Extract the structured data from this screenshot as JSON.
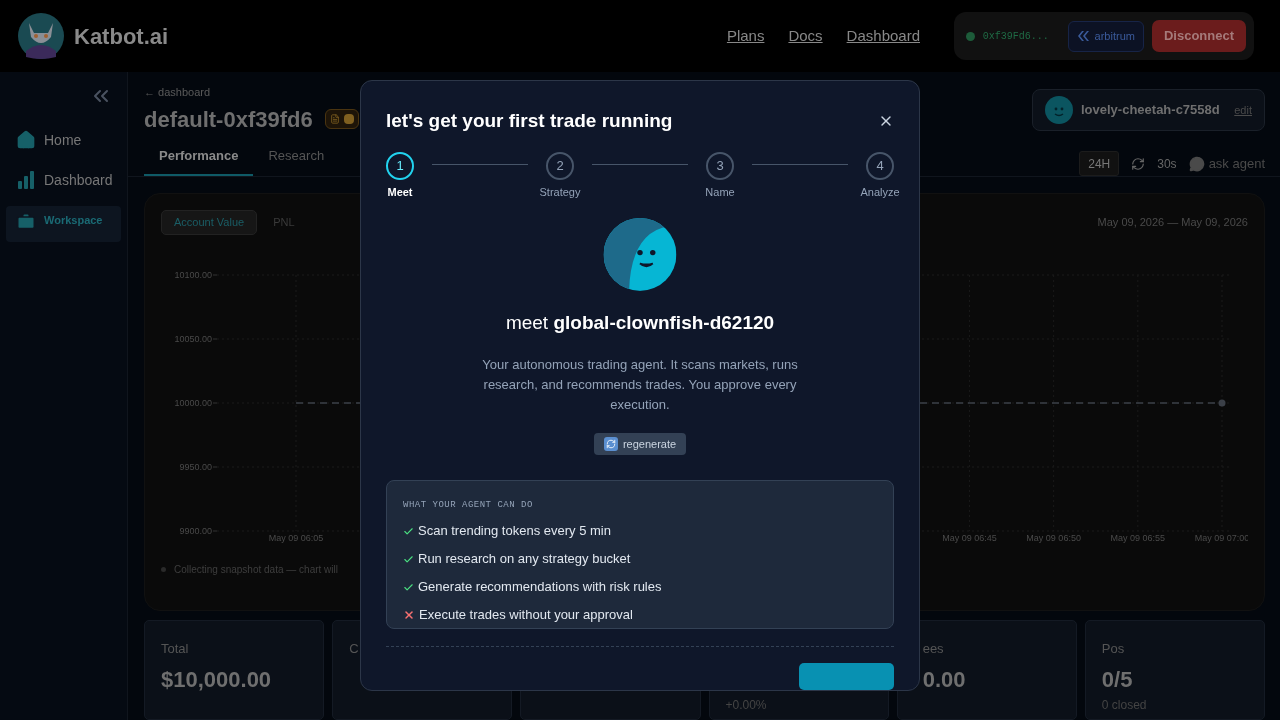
{
  "header": {
    "brand": "Katbot.ai",
    "nav": [
      "Plans",
      "Docs",
      "Dashboard"
    ],
    "wallet": {
      "address": "0xf39Fd6...",
      "connected": true,
      "network": "arbitrum",
      "disconnect": "Disconnect"
    }
  },
  "sidebar": {
    "items": [
      {
        "label": "Home",
        "selected": false
      },
      {
        "label": "Dashboard",
        "selected": false
      },
      {
        "label": "Workspace",
        "selected": true
      }
    ]
  },
  "page": {
    "breadcrumb": "← dashboard",
    "title": "default-0xf39fd6",
    "tabs": [
      {
        "label": "Performance",
        "selected": true
      },
      {
        "label": "Research",
        "selected": false
      }
    ],
    "agent": {
      "name": "lovely-cheetah-c7558d",
      "edit": "edit"
    },
    "controls": {
      "range": "24H",
      "refresh": "30s",
      "ask": "ask agent"
    }
  },
  "chart_panel": {
    "toggles": [
      {
        "label": "Account Value",
        "selected": true
      },
      {
        "label": "PNL",
        "selected": false
      }
    ],
    "date_range": "May 09, 2026 — May 09, 2026",
    "note": "Collecting snapshot data — chart will",
    "chart_data": {
      "type": "line",
      "categories": [
        "May 09 06:05",
        null,
        null,
        null,
        null,
        null,
        null,
        null,
        "May 09 06:45",
        "May 09 06:50",
        "May 09 06:55",
        "May 09 07:00"
      ],
      "ylim": [
        9900,
        10100
      ],
      "yticks": [
        {
          "value": 10100,
          "label": "10100.00"
        },
        {
          "value": 10050,
          "label": "10050.00"
        },
        {
          "value": 10000,
          "label": "10000.00"
        },
        {
          "value": 9950,
          "label": "9950.00"
        },
        {
          "value": 9900,
          "label": "9900.00"
        }
      ],
      "grid": true,
      "series": [
        {
          "color": "#3b4048",
          "line_style": "dashed",
          "values": [
            10000,
            null,
            null,
            null,
            null,
            null,
            null,
            null,
            10000,
            10000,
            10000,
            10000
          ]
        }
      ]
    }
  },
  "stats": [
    {
      "kind": "filled",
      "label": "Total",
      "value": "$10,000.00"
    },
    {
      "kind": "filled",
      "label": "C"
    },
    {
      "kind": "blank"
    },
    {
      "kind": "filled",
      "sub": "+0.00%"
    },
    {
      "kind": "filled",
      "label": "ees",
      "value": "0.00",
      "clipped": true
    },
    {
      "kind": "filled",
      "label": "Pos",
      "value": "0/5",
      "sub": "0 closed"
    }
  ],
  "modal": {
    "title": "let's get your first trade running",
    "steps": [
      {
        "number": "1",
        "label": "Meet",
        "selected": true
      },
      {
        "number": "2",
        "label": "Strategy",
        "selected": false
      },
      {
        "number": "3",
        "label": "Name",
        "selected": false
      },
      {
        "number": "4",
        "label": "Analyze",
        "selected": false
      }
    ],
    "greeting": "meet **global-clownfish-d62120**",
    "description": "Your autonomous trading agent. It scans markets, runs research, and recommends trades. You approve every execution.",
    "regenerate": "regenerate",
    "capabilities": {
      "heading": "WHAT YOUR AGENT CAN DO",
      "items": [
        {
          "kind": "allowed",
          "text": "Scan trending tokens every 5 min"
        },
        {
          "kind": "allowed",
          "text": "Run research on any strategy bucket"
        },
        {
          "kind": "allowed",
          "text": "Generate recommendations with risk rules"
        },
        {
          "kind": "denied",
          "text": "Execute trades without your approval"
        }
      ]
    }
  }
}
